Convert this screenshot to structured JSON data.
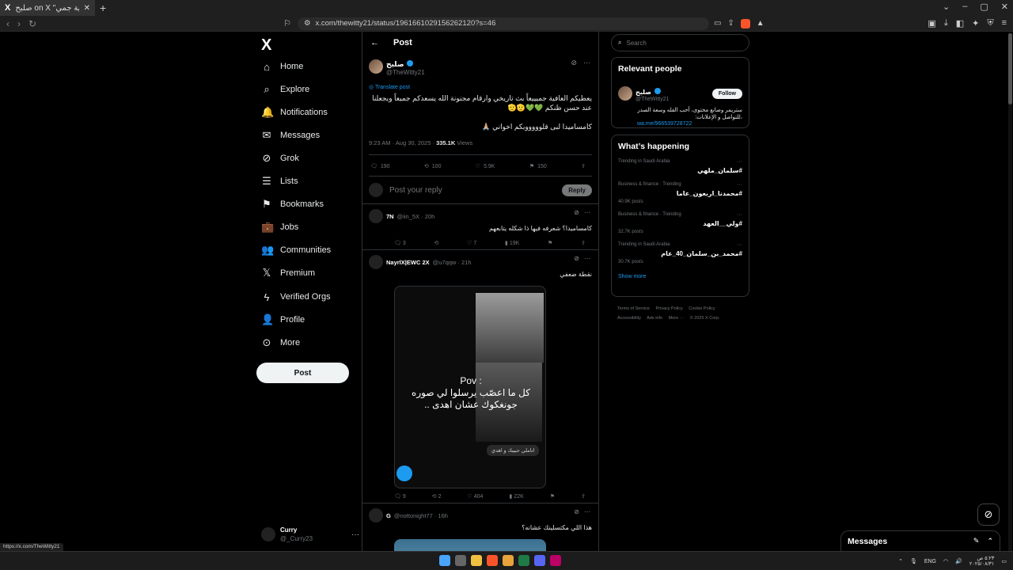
{
  "browser": {
    "tab_title": "صلبح on X \"يعطيكم العافية جمي...",
    "tab_icon": "X",
    "url": "x.com/thewitty21/status/1961661029156262120?s=46",
    "status_url": "https://x.com/TheWitty21"
  },
  "sidebar": {
    "logo": "X",
    "items": [
      {
        "label": "Home",
        "icon": "home-icon",
        "glyph": "⌂"
      },
      {
        "label": "Explore",
        "icon": "search-icon",
        "glyph": "⌕"
      },
      {
        "label": "Notifications",
        "icon": "bell-icon",
        "glyph": "🔔"
      },
      {
        "label": "Messages",
        "icon": "envelope-icon",
        "glyph": "✉"
      },
      {
        "label": "Grok",
        "icon": "grok-icon",
        "glyph": "⊘"
      },
      {
        "label": "Lists",
        "icon": "list-icon",
        "glyph": "☰"
      },
      {
        "label": "Bookmarks",
        "icon": "bookmark-icon",
        "glyph": "⚑"
      },
      {
        "label": "Jobs",
        "icon": "briefcase-icon",
        "glyph": "💼"
      },
      {
        "label": "Communities",
        "icon": "people-icon",
        "glyph": "👥"
      },
      {
        "label": "Premium",
        "icon": "x-logo-icon",
        "glyph": "𝕏"
      },
      {
        "label": "Verified Orgs",
        "icon": "lightning-icon",
        "glyph": "ϟ"
      },
      {
        "label": "Profile",
        "icon": "person-icon",
        "glyph": "👤"
      },
      {
        "label": "More",
        "icon": "more-circle-icon",
        "glyph": "⊙"
      }
    ],
    "post_button": "Post",
    "account": {
      "name": "Curry",
      "handle": "@_Curry23"
    }
  },
  "main": {
    "header": "Post",
    "tweet": {
      "name": "صلبح",
      "handle": "@TheWitty21",
      "translate": "Translate post",
      "text1": "يعطيكم العافية جميييعاً بث تاريخي وارقام مجنونة الله يسعدكم جميعاً ويجعلنا عند حسن ظنكم 💚💚🫡🫡",
      "text2": "كامساميدا لبى قلوووووبكم اخواني 🙏🏼",
      "time": "9:23 AM · Aug 30, 2025 · ",
      "views_count": "335.1K",
      "views_label": " Views",
      "replies": "190",
      "reposts": "100",
      "likes": "5.9K",
      "bookmarks": "150"
    },
    "reply_placeholder": "Post your reply",
    "reply_button": "Reply",
    "replies": [
      {
        "name": "7N",
        "handle": "@iin_5X · 20h",
        "text": "كامساميدا؟ شعرفه فيها ذا شكله يتابعهم",
        "replies": "3",
        "reposts": "",
        "likes": "7",
        "views": "19K"
      },
      {
        "name": "NayrlX|EWC 2X",
        "handle": "@u7qqw · 21h",
        "text": "نقطة ضعفي",
        "replies": "9",
        "reposts": "2",
        "likes": "404",
        "views": "22K",
        "media_caption_top": "Pov :",
        "media_caption_body": "كل ما اعصّب يرسلوا لي صوره جونغكوك عشان اهدى ..",
        "media_chip": "اتاملي حبيبك و اهدي"
      },
      {
        "name": "G",
        "handle": "@nottonight77 · 16h",
        "text": "هذا اللي مكتسلينك عشانه؟"
      }
    ]
  },
  "right": {
    "search_placeholder": "Search",
    "relevant_title": "Relevant people",
    "person": {
      "name": "صلبح",
      "handle": "@TheWitty21",
      "follow": "Follow",
      "bio": "ستريمر وصانع محتوى، أحب الفله وسعة الصدر ،للتواصل و الإعلانات:",
      "link": "wa.me/966539728722"
    },
    "happening_title": "What’s happening",
    "trends": [
      {
        "category": "Trending in Saudi Arabia",
        "tag": "#سلمان_ملهي",
        "posts": ""
      },
      {
        "category": "Business & finance · Trending",
        "tag": "#محمدنا_اربعون_عاما",
        "posts": "40.9K posts"
      },
      {
        "category": "Business & finance · Trending",
        "tag": "#ولي__العهد",
        "posts": "32.7K posts"
      },
      {
        "category": "Trending in Saudi Arabia",
        "tag": "#محمد_بن_سلمان_40_عام",
        "posts": "30.7K posts"
      }
    ],
    "show_more": "Show more",
    "footer": [
      "Terms of Service",
      "Privacy Policy",
      "Cookie Policy",
      "Accessibility",
      "Ads info",
      "More ···",
      "© 2025 X Corp."
    ]
  },
  "messages_drawer": "Messages",
  "taskbar": {
    "lang": "ENG",
    "time": "٥:٢٣ ص",
    "date": "٢٠٢٥/٠٨/٣١"
  }
}
